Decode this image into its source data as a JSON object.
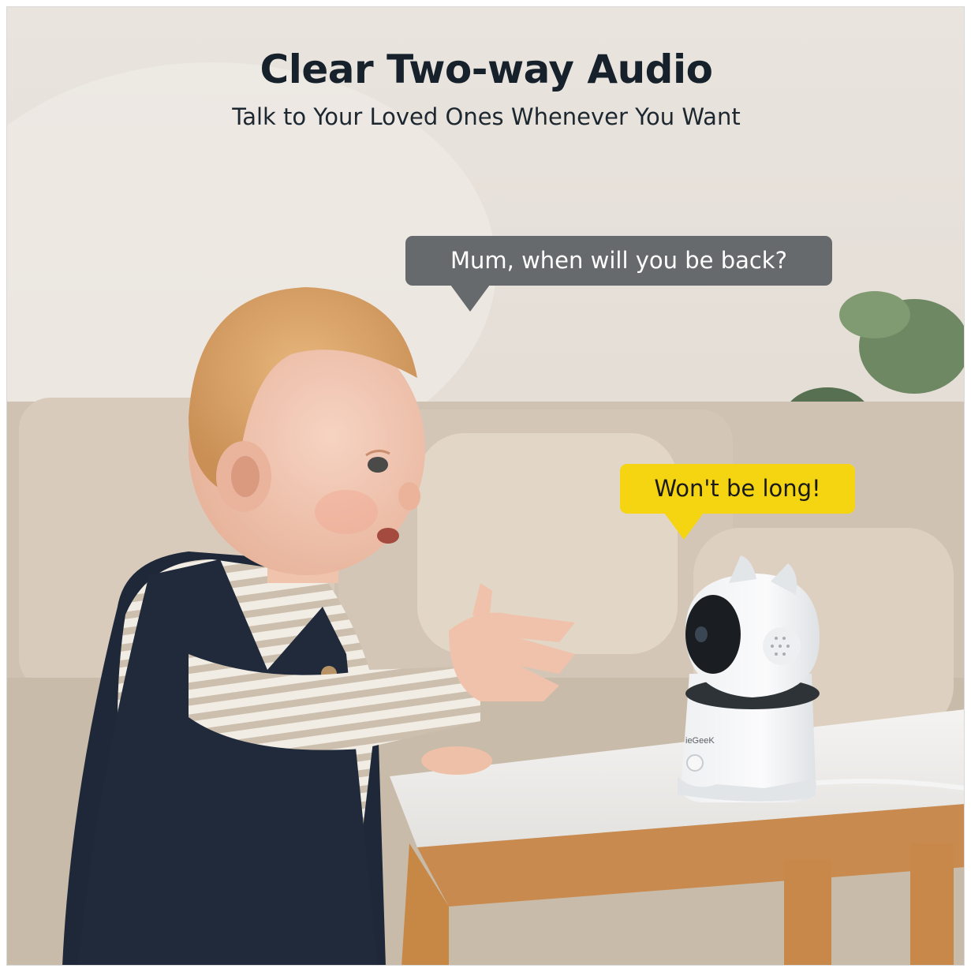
{
  "header": {
    "title": "Clear Two-way Audio",
    "subtitle": "Talk to Your Loved Ones Whenever You Want"
  },
  "bubbles": {
    "child_message": "Mum, when will you be back?",
    "parent_reply": "Won't be long!"
  },
  "product": {
    "brand": "ieGeeK"
  },
  "colors": {
    "title": "#16212b",
    "grey_bubble": "#676a6c",
    "yellow_bubble": "#f5d511"
  }
}
